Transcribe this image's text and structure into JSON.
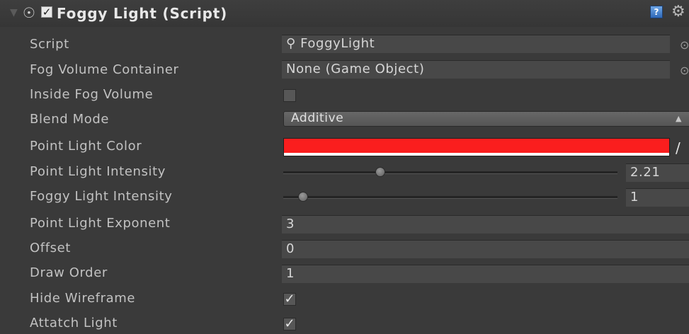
{
  "component": {
    "title": "Foggy Light (Script)",
    "enabled": true,
    "icons": {
      "foldout": "foldout-arrow-icon",
      "component": "light-bulb-icon",
      "help": "help-book-icon",
      "settings": "gear-icon"
    }
  },
  "fields": {
    "script": {
      "label": "Script",
      "value": "FoggyLight",
      "icon": "⚲"
    },
    "fog_volume_container": {
      "label": "Fog Volume Container",
      "value": "None (Game Object)"
    },
    "inside_fog_volume": {
      "label": "Inside Fog Volume",
      "checked": false
    },
    "blend_mode": {
      "label": "Blend Mode",
      "value": "Additive"
    },
    "point_light_color": {
      "label": "Point Light Color",
      "color": "#fa1e1e"
    },
    "point_light_intensity": {
      "label": "Point Light Intensity",
      "value": "2.21",
      "fraction": 0.29
    },
    "foggy_light_intensity": {
      "label": "Foggy Light Intensity",
      "value": "1",
      "fraction": 0.06
    },
    "point_light_exponent": {
      "label": "Point Light Exponent",
      "value": "3"
    },
    "offset": {
      "label": "Offset",
      "value": "0"
    },
    "draw_order": {
      "label": "Draw Order",
      "value": "1"
    },
    "hide_wireframe": {
      "label": "Hide Wireframe",
      "checked": true
    },
    "attatch_light": {
      "label": "Attatch Light",
      "checked": true
    }
  }
}
